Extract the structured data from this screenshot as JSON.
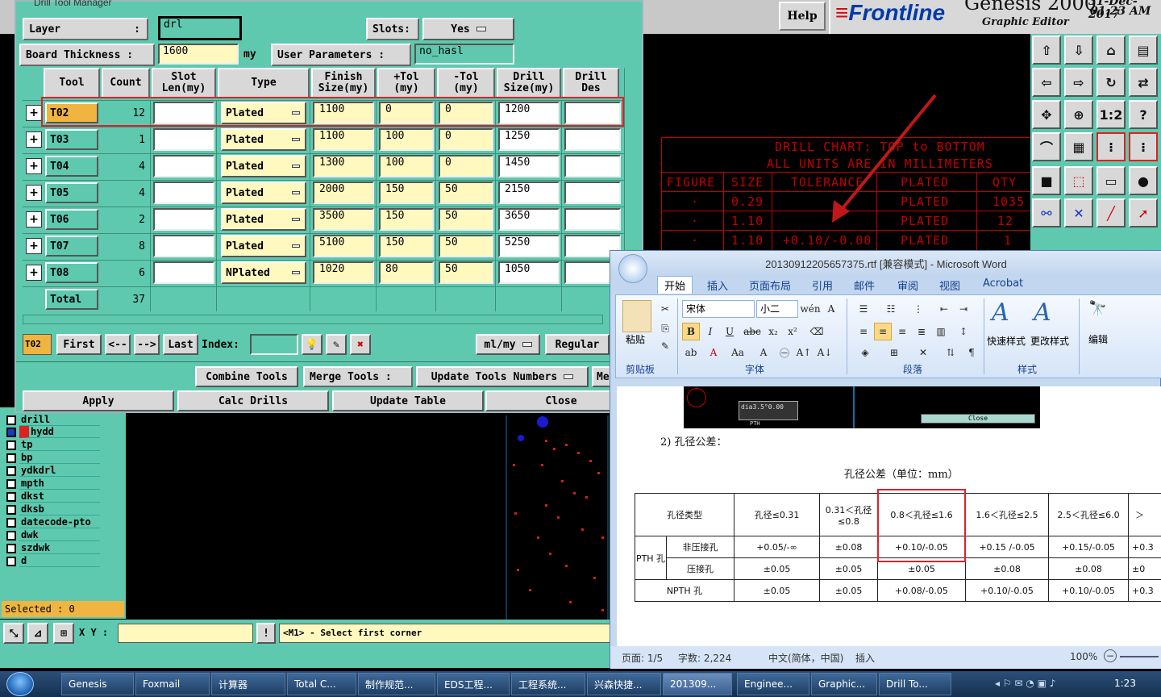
{
  "genesis": {
    "help_label": "Help",
    "brand_logo": "Frontline",
    "brand_title": "Genesis 2000",
    "brand_subtitle": "Graphic Editor",
    "date": "31-Dec-2017",
    "time": "01:23 AM",
    "toolbox_icons": [
      "cursor-icon",
      "down-icon",
      "home-icon",
      "window-icon",
      "left-icon",
      "right-icon",
      "rotate-icon",
      "flip-icon",
      "fit-icon",
      "center-icon",
      "scale-1-2-icon",
      "help-icon",
      "measure-icon",
      "grid-icon",
      "snap-icon",
      "snap2-icon",
      "box-icon",
      "shape-icon",
      "ruler-icon",
      "circle-icon",
      "net-icon",
      "cross-icon",
      "line-icon",
      "arrow-icon"
    ],
    "toolbox_labels": [
      "1:2",
      "?"
    ],
    "drill_chart": {
      "line1": "DRILL CHART: TOP to BOTTOM",
      "line2": "ALL UNITS ARE IN MILLIMETERS",
      "headers": [
        "FIGURE",
        "SIZE",
        "TOLERANCE",
        "PLATED",
        "QTY"
      ],
      "rows": [
        {
          "figure": "·",
          "size": "0.29",
          "tol": "",
          "plated": "PLATED",
          "qty": "1035"
        },
        {
          "figure": "·",
          "size": "1.10",
          "tol": "",
          "plated": "PLATED",
          "qty": "12"
        },
        {
          "figure": "·",
          "size": "1.10",
          "tol": "+0.10/-0.00",
          "plated": "PLATED",
          "qty": "1"
        }
      ]
    },
    "layers": [
      "drill",
      "hydd",
      "tp",
      "bp",
      "ydkdrl",
      "mpth",
      "dkst",
      "dksb",
      "datecode-pto",
      "dwk",
      "szdwk",
      "d"
    ],
    "selected_text": "Selected : 0",
    "xy_label": "X Y :",
    "xy_value": "",
    "status_message": "<M1> - Select first corner",
    "status_mark": "!"
  },
  "dtm": {
    "title": "Drill Tool Manager",
    "layer_label": "Layer",
    "layer_sep": ":",
    "layer_value": "drl",
    "slots_label": "Slots:",
    "slots_value": "Yes",
    "board_label": "Board Thickness :",
    "board_value": "1600",
    "board_unit": "my",
    "user_params_label": "User Parameters :",
    "user_params_value": "no_hasl",
    "headers": [
      "Tool",
      "Count",
      "Slot\nLen(my)",
      "Type",
      "Finish\nSize(my)",
      "+Tol\n(my)",
      "-Tol\n(my)",
      "Drill\nSize(my)",
      "Drill\nDes"
    ],
    "rows": [
      {
        "tool": "T02",
        "count": "12",
        "slot": "",
        "type": "Plated",
        "finish": "1100",
        "ptol": "0",
        "mtol": "0",
        "drill": "1200",
        "des": ""
      },
      {
        "tool": "T03",
        "count": "1",
        "slot": "",
        "type": "Plated",
        "finish": "1100",
        "ptol": "100",
        "mtol": "0",
        "drill": "1250",
        "des": ""
      },
      {
        "tool": "T04",
        "count": "4",
        "slot": "",
        "type": "Plated",
        "finish": "1300",
        "ptol": "100",
        "mtol": "0",
        "drill": "1450",
        "des": ""
      },
      {
        "tool": "T05",
        "count": "4",
        "slot": "",
        "type": "Plated",
        "finish": "2000",
        "ptol": "150",
        "mtol": "50",
        "drill": "2150",
        "des": ""
      },
      {
        "tool": "T06",
        "count": "2",
        "slot": "",
        "type": "Plated",
        "finish": "3500",
        "ptol": "150",
        "mtol": "50",
        "drill": "3650",
        "des": ""
      },
      {
        "tool": "T07",
        "count": "8",
        "slot": "",
        "type": "Plated",
        "finish": "5100",
        "ptol": "150",
        "mtol": "50",
        "drill": "5250",
        "des": ""
      },
      {
        "tool": "T08",
        "count": "6",
        "slot": "",
        "type": "NPlated",
        "finish": "1020",
        "ptol": "80",
        "mtol": "50",
        "drill": "1050",
        "des": ""
      }
    ],
    "total_label": "Total",
    "total_count": "37",
    "current_tool": "T02",
    "nav": {
      "first": "First",
      "prev": "<--",
      "next": "-->",
      "last": "Last",
      "index_label": "Index:",
      "index_value": ""
    },
    "units_value": "ml/my",
    "regular_label": "Regular",
    "combine_label": "Combine Tools",
    "merge_label": "Merge Tools :",
    "update_numbers_label": "Update Tools Numbers",
    "me_label": "Me",
    "apply_label": "Apply",
    "calc_label": "Calc Drills",
    "update_table_label": "Update Table",
    "close_label": "Close"
  },
  "word": {
    "title": "20130912205657375.rtf [兼容模式] - Microsoft Word",
    "tabs": [
      "开始",
      "插入",
      "页面布局",
      "引用",
      "邮件",
      "审阅",
      "视图",
      "Acrobat"
    ],
    "font_name": "宋体",
    "font_size": "小二",
    "groups": [
      "剪贴板",
      "字体",
      "段落",
      "样式",
      "编辑"
    ],
    "paste_label": "粘贴",
    "quick_style_label": "快速样式",
    "change_style_label": "更改样式",
    "edit_label": "编辑",
    "doc": {
      "section": "2)  孔径公差：",
      "caption": "孔径公差（单位：mm）",
      "thumb_tag": "dia3.5°0.00",
      "thumb_small": "PTH",
      "thumb_close": "Close",
      "headers": [
        "孔径类型",
        "孔径≤0.31",
        "0.31＜孔径≤0.8",
        "0.8＜孔径≤1.6",
        "1.6＜孔径≤2.5",
        "2.5＜孔径≤6.0",
        "＞"
      ],
      "pth_label": "PTH 孔",
      "rows": [
        [
          "非压接孔",
          "+0.05/-∞",
          "±0.08",
          "+0.10/-0.05",
          "+0.15 /-0.05",
          "+0.15/-0.05",
          "+0.3"
        ],
        [
          "压接孔",
          "±0.05",
          "±0.05",
          "±0.05",
          "±0.08",
          "±0.08",
          "±0"
        ],
        [
          "NPTH 孔",
          "±0.05",
          "±0.05",
          "+0.08/-0.05",
          "+0.10/-0.05",
          "+0.10/-0.05",
          "+0.3"
        ]
      ]
    },
    "status": {
      "page": "页面: 1/5",
      "words": "字数: 2,224",
      "lang": "中文(简体，中国)",
      "mode": "插入",
      "zoom": "100%"
    }
  },
  "taskbar": {
    "items": [
      "Genesis",
      "Foxmail",
      "计算器",
      "Total C...",
      "制作规范...",
      "EDS工程...",
      "工程系统...",
      "兴森快捷...",
      "201309...",
      "Enginee...",
      "Graphic...",
      "Drill To..."
    ],
    "clock": "1:23"
  },
  "colors": {
    "teal": "#5ec9ae",
    "highlight": "#e0202a",
    "chart_red": "#c00000",
    "input_yellow": "#fff9c0",
    "selected_orange": "#f0b440"
  }
}
